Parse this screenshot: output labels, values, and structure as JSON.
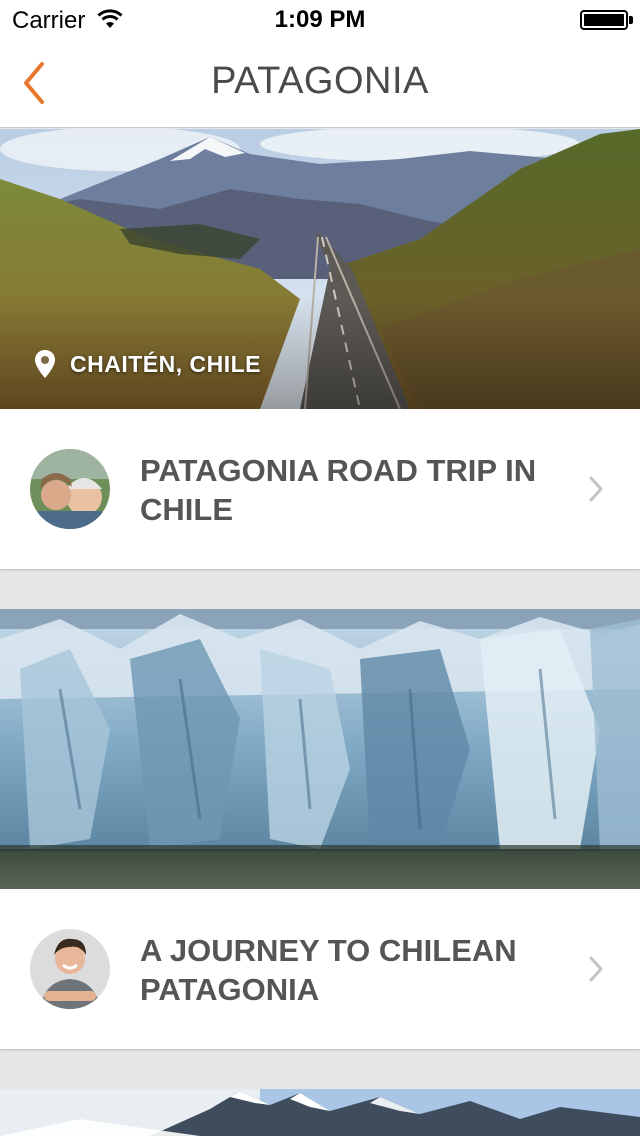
{
  "status_bar": {
    "carrier": "Carrier",
    "time": "1:09 PM"
  },
  "nav": {
    "title": "PATAGONIA",
    "back_icon": "chevron-left-icon",
    "accent_color": "#e8762c"
  },
  "cards": [
    {
      "location": "CHAITÉN, CHILE",
      "image": "mountain-road-landscape",
      "title": "PATAGONIA ROAD TRIP IN CHILE",
      "avatar": "couple-with-helmet"
    },
    {
      "image": "glacier-ice-wall",
      "title": "A JOURNEY TO CHILEAN PATAGONIA",
      "avatar": "smiling-man"
    },
    {
      "image": "snowy-mountain-peaks"
    }
  ]
}
